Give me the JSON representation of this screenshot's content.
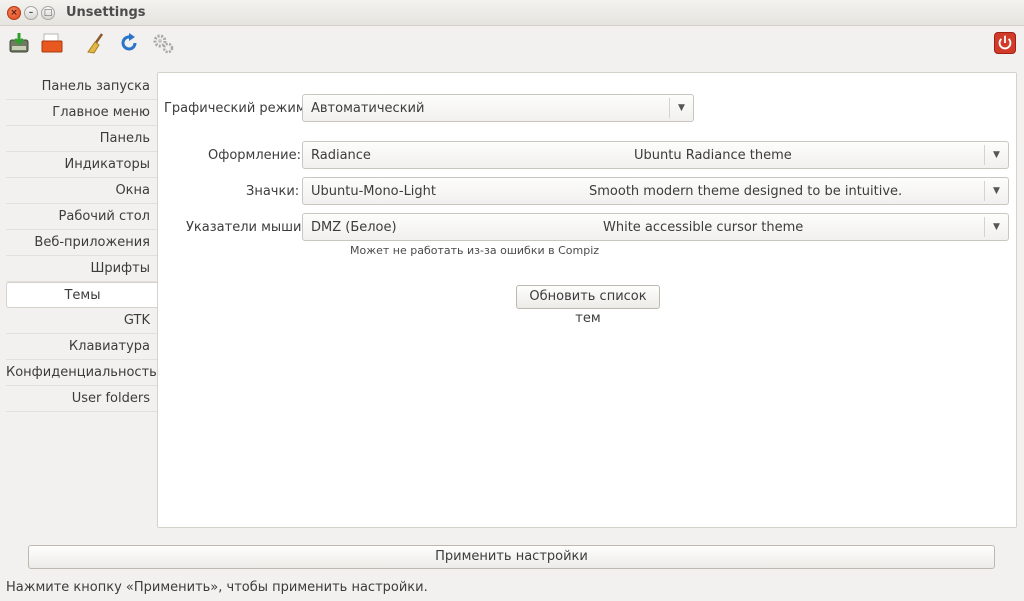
{
  "window": {
    "title": "Unsettings"
  },
  "window_controls": {
    "close": "×",
    "minimize": "–",
    "maximize": "□"
  },
  "toolbar": {
    "icons": [
      "save-icon",
      "open-icon",
      "broom-icon",
      "refresh-icon",
      "gears-icon"
    ],
    "quit_icon": "power-icon"
  },
  "sidebar": {
    "items": [
      {
        "label": "Панель запуска"
      },
      {
        "label": "Главное меню"
      },
      {
        "label": "Панель"
      },
      {
        "label": "Индикаторы"
      },
      {
        "label": "Окна"
      },
      {
        "label": "Рабочий стол"
      },
      {
        "label": "Веб-приложения"
      },
      {
        "label": "Шрифты"
      },
      {
        "label": "Темы",
        "active": true
      },
      {
        "label": "GTK"
      },
      {
        "label": "Клавиатура"
      },
      {
        "label": "Конфиденциальность"
      },
      {
        "label": "User folders"
      }
    ]
  },
  "themes": {
    "graphics_mode": {
      "label": "Графический режим:",
      "value": "Автоматический"
    },
    "appearance": {
      "label": "Оформление:",
      "value": "Radiance",
      "description": "Ubuntu Radiance theme"
    },
    "icons": {
      "label": "Значки:",
      "value": "Ubuntu-Mono-Light",
      "description": "Smooth modern theme designed to be intuitive."
    },
    "cursors": {
      "label": "Указатели мыши:",
      "value": "DMZ (Белое)",
      "description": "White accessible cursor theme"
    },
    "compiz_note": "Может не работать из-за ошибки в Compiz",
    "refresh_button": "Обновить список тем"
  },
  "apply_button": "Применить настройки",
  "status_text": "Нажмите кнопку «Применить», чтобы применить настройки.",
  "colors": {
    "accent_close": "#df4a1c",
    "quit": "#d23a2a",
    "panel_bg": "#ffffff",
    "window_bg": "#f2f1f0"
  }
}
